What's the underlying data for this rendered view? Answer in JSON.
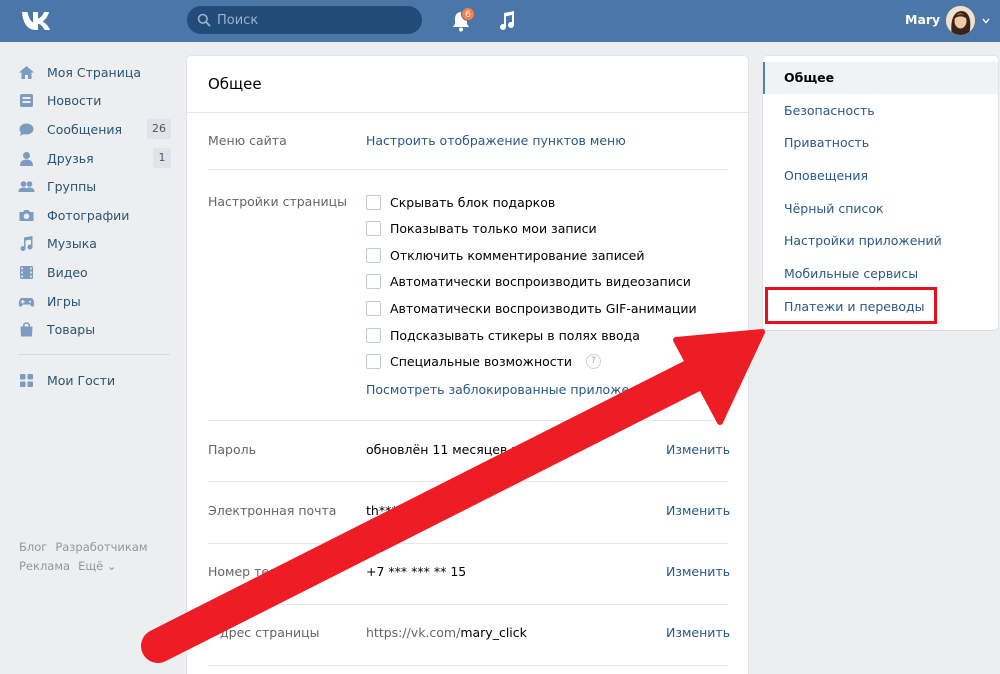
{
  "header": {
    "search_placeholder": "Поиск",
    "notifications_count": "6",
    "user_name": "Mary",
    "accent": "#4a76a8"
  },
  "sidebar": {
    "items": [
      {
        "label": "Моя Страница",
        "icon": "home-icon"
      },
      {
        "label": "Новости",
        "icon": "news-icon"
      },
      {
        "label": "Сообщения",
        "icon": "messages-icon",
        "count": "26"
      },
      {
        "label": "Друзья",
        "icon": "friends-icon",
        "count": "1"
      },
      {
        "label": "Группы",
        "icon": "groups-icon"
      },
      {
        "label": "Фотографии",
        "icon": "camera-icon"
      },
      {
        "label": "Музыка",
        "icon": "music-icon"
      },
      {
        "label": "Видео",
        "icon": "video-icon"
      },
      {
        "label": "Игры",
        "icon": "gamepad-icon"
      },
      {
        "label": "Товары",
        "icon": "bag-icon"
      }
    ],
    "extra": {
      "label": "Мои Гости",
      "icon": "apps-icon"
    },
    "footer": [
      "Блог",
      "Разработчикам",
      "Реклама",
      "Ещё ⌄"
    ]
  },
  "main": {
    "title": "Общее",
    "menu_label": "Меню сайта",
    "menu_link": "Настроить отображение пунктов меню",
    "page_settings_label": "Настройки страницы",
    "checkboxes": [
      "Скрывать блок подарков",
      "Показывать только мои записи",
      "Отключить комментирование записей",
      "Автоматически воспроизводить видеозаписи",
      "Автоматически воспроизводить GIF-анимации",
      "Подсказывать стикеры в полях ввода",
      "Специальные возможности"
    ],
    "help_symbol": "?",
    "blocked_apps_link": "Посмотреть заблокированные приложе",
    "password_label": "Пароль",
    "password_value": "обновлён 11 месяцев н",
    "email_label": "Электронная почта",
    "email_value": "th*** ...om",
    "phone_label": "Номер теле",
    "phone_value": "+7 *** *** ** 15",
    "address_label": "дрес страницы",
    "address_prefix": "https://vk.com/",
    "address_value": "mary_click",
    "change_label": "Изменить"
  },
  "right_nav": {
    "items": [
      "Общее",
      "Безопасность",
      "Приватность",
      "Оповещения",
      "Чёрный список",
      "Настройки приложений",
      "Мобильные сервисы",
      "Платежи и переводы"
    ]
  },
  "annotation_color": "#e8101d"
}
